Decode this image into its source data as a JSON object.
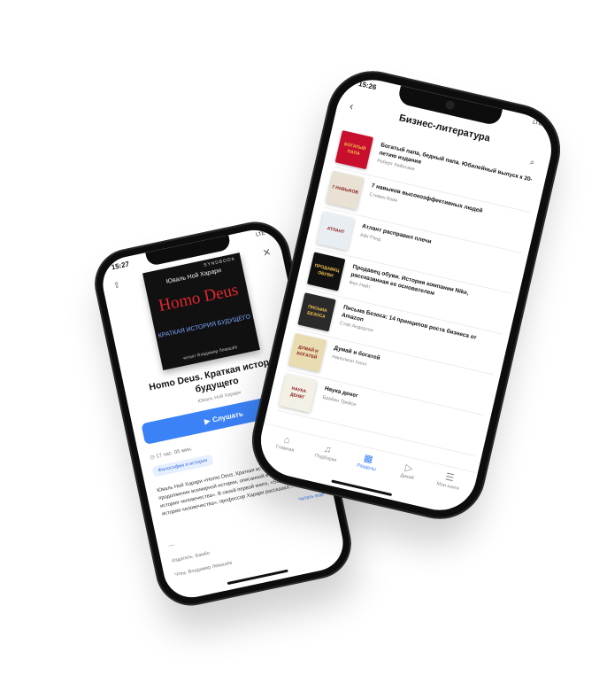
{
  "left_phone": {
    "status_time": "15:27",
    "status_network": "LTE",
    "cover": {
      "publisher_mark": "SYNDBOOK",
      "author": "Юваль Ной Харари",
      "title": "Homo Deus",
      "subtitle": "КРАТКАЯ ИСТОРИЯ БУДУЩЕГО",
      "reader": "читает Владимир Левашёв"
    },
    "title": "Homo Deus. Краткая история будущего",
    "author": "Юваль Ной Харари",
    "listen_label": "Слушать",
    "duration": "17 час. 05 мин.",
    "category_chip": "Философия и история",
    "description": "Юваль Ной Харари «Homo Deus. Краткая история будущего» — продолжение всемирной истории, описанной в «Sapiens. Краткая история человечества». В своей первой книге, «Sapiens. Краткая история человечества», профессор Харари рассказал...",
    "read_more": "Читать еще",
    "publisher": "Издатель: Бамбо",
    "reader_line": "Чтец: Владимир Левашёв"
  },
  "right_phone": {
    "status_time": "15:26",
    "status_network": "LTE",
    "header_title": "Бизнес-литература",
    "books": [
      {
        "title": "Богатый папа, бедный папа. Юбилейный выпуск к 20-летию издания",
        "author": "Роберт Кийосаки",
        "cover_color": "#c8102e",
        "cover_text": "БОГАТЫЙ ПАПА"
      },
      {
        "title": "7 навыков высокоэффективных людей",
        "author": "Стивен Кови",
        "cover_color": "#e8e1d4",
        "cover_text": "7 НАВЫКОВ"
      },
      {
        "title": "Атлант расправил плечи",
        "author": "Айн Рэнд",
        "cover_color": "#e9eef3",
        "cover_text": "АТЛАНТ"
      },
      {
        "title": "Продавец обуви. История компании Nike, рассказанная ее основателем",
        "author": "Фил Найт",
        "cover_color": "#111111",
        "cover_text": "ПРОДАВЕЦ ОБУВИ"
      },
      {
        "title": "Письма Безоса: 14 принципов роста бизнеса от Amazon",
        "author": "Стив Андерсон",
        "cover_color": "#2a2a2a",
        "cover_text": "ПИСЬМА БЕЗОСА"
      },
      {
        "title": "Думай и богатей",
        "author": "Наполеон Хилл",
        "cover_color": "#e8dcb0",
        "cover_text": "ДУМАЙ И БОГАТЕЙ"
      },
      {
        "title": "Наука денег",
        "author": "Брейан Трейси",
        "cover_color": "#f3f0e6",
        "cover_text": "НАУКА ДЕНЕГ"
      }
    ],
    "tabs": [
      {
        "label": "Главная",
        "icon": "home-icon",
        "glyph": "⌂"
      },
      {
        "label": "Подборки",
        "icon": "headphones-icon",
        "glyph": "♫"
      },
      {
        "label": "Разделы",
        "icon": "sections-icon",
        "glyph": "▦"
      },
      {
        "label": "Дикий",
        "icon": "play-icon",
        "glyph": "▷"
      },
      {
        "label": "Мои книги",
        "icon": "library-icon",
        "glyph": "☰"
      }
    ],
    "active_tab": "Разделы"
  }
}
